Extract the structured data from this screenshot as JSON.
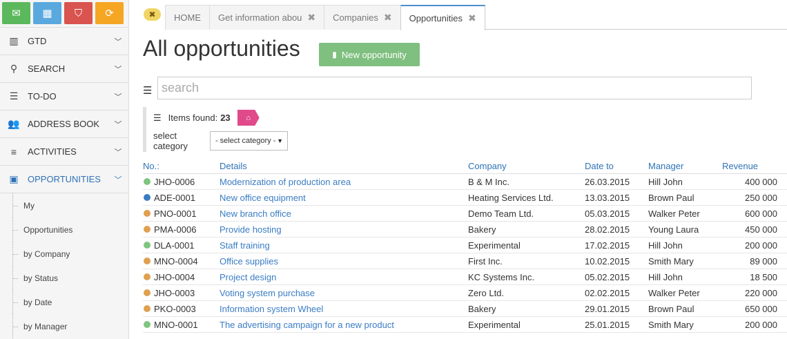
{
  "quick_buttons": [
    {
      "name": "mail",
      "color": "#5cb85c"
    },
    {
      "name": "calendar",
      "color": "#5aa9de"
    },
    {
      "name": "bookmark",
      "color": "#d9534f"
    },
    {
      "name": "refresh",
      "color": "#f5a623"
    }
  ],
  "sidebar": {
    "items": [
      {
        "label": "GTD",
        "icon": "building-icon"
      },
      {
        "label": "SEARCH",
        "icon": "search-icon"
      },
      {
        "label": "TO-DO",
        "icon": "list-icon"
      },
      {
        "label": "ADDRESS BOOK",
        "icon": "users-icon"
      },
      {
        "label": "ACTIVITIES",
        "icon": "bars-icon"
      },
      {
        "label": "OPPORTUNITIES",
        "icon": "money-icon",
        "active": true
      }
    ],
    "subitems": [
      "My",
      "Opportunities",
      "by Company",
      "by Status",
      "by Date",
      "by Manager"
    ]
  },
  "tabs": [
    {
      "label": "HOME",
      "closable": false
    },
    {
      "label": "Get information abou",
      "closable": true
    },
    {
      "label": "Companies",
      "closable": true
    },
    {
      "label": "Opportunities",
      "closable": true,
      "active": true
    }
  ],
  "page": {
    "title": "All opportunities",
    "new_button": "New opportunity",
    "search_placeholder": "search",
    "items_found_label": "Items found:",
    "items_found_count": "23",
    "select_category_label": "select category",
    "select_category_value": "- select category -"
  },
  "table": {
    "headers": [
      "No.:",
      "Details",
      "Company",
      "Date to",
      "Manager",
      "Revenue"
    ],
    "rows": [
      {
        "status": "#7fc47f",
        "no": "JHO-0006",
        "details": "Modernization of production area",
        "company": "B & M Inc.",
        "date": "26.03.2015",
        "manager": "Hill John",
        "revenue": "400 000"
      },
      {
        "status": "#3a7cc4",
        "no": "ADE-0001",
        "details": "New office equipment",
        "company": "Heating Services Ltd.",
        "date": "13.03.2015",
        "manager": "Brown Paul",
        "revenue": "250 000"
      },
      {
        "status": "#e0a050",
        "no": "PNO-0001",
        "details": "New branch office",
        "company": "Demo Team Ltd.",
        "date": "05.03.2015",
        "manager": "Walker Peter",
        "revenue": "600 000"
      },
      {
        "status": "#e0a050",
        "no": "PMA-0006",
        "details": "Provide hosting",
        "company": "Bakery",
        "date": "28.02.2015",
        "manager": "Young Laura",
        "revenue": "450 000"
      },
      {
        "status": "#7fc47f",
        "no": "DLA-0001",
        "details": "Staff training",
        "company": "Experimental",
        "date": "17.02.2015",
        "manager": "Hill John",
        "revenue": "200 000"
      },
      {
        "status": "#e0a050",
        "no": "MNO-0004",
        "details": "Office supplies",
        "company": "First Inc.",
        "date": "10.02.2015",
        "manager": "Smith Mary",
        "revenue": "89 000"
      },
      {
        "status": "#e0a050",
        "no": "JHO-0004",
        "details": "Project design",
        "company": "KC Systems Inc.",
        "date": "05.02.2015",
        "manager": "Hill John",
        "revenue": "18 500"
      },
      {
        "status": "#e0a050",
        "no": "JHO-0003",
        "details": "Voting system purchase",
        "company": "Zero Ltd.",
        "date": "02.02.2015",
        "manager": "Walker Peter",
        "revenue": "220 000"
      },
      {
        "status": "#e0a050",
        "no": "PKO-0003",
        "details": "Information system Wheel",
        "company": "Bakery",
        "date": "29.01.2015",
        "manager": "Brown Paul",
        "revenue": "650 000"
      },
      {
        "status": "#7fc47f",
        "no": "MNO-0001",
        "details": "The advertising campaign for a new product",
        "company": "Experimental",
        "date": "25.01.2015",
        "manager": "Smith Mary",
        "revenue": "200 000"
      }
    ]
  }
}
